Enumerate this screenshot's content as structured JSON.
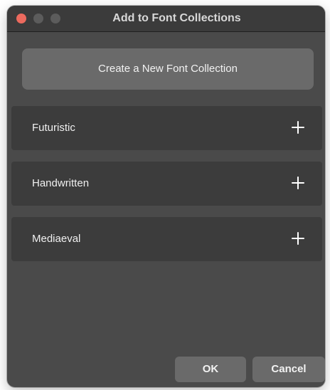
{
  "window": {
    "title": "Add to Font Collections"
  },
  "create_button": {
    "label": "Create a New Font Collection"
  },
  "collections": [
    {
      "label": "Futuristic",
      "action_icon": "plus-icon"
    },
    {
      "label": "Handwritten",
      "action_icon": "plus-icon"
    },
    {
      "label": "Mediaeval",
      "action_icon": "plus-icon"
    }
  ],
  "footer": {
    "ok_label": "OK",
    "cancel_label": "Cancel"
  },
  "colors": {
    "window_background": "#4a4a4a",
    "row_background": "#3c3c3c",
    "button_background": "#6a6a6a",
    "close_button": "#ec6a5e"
  }
}
